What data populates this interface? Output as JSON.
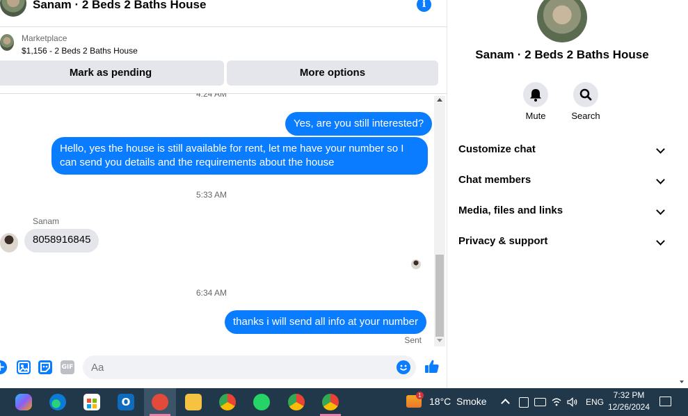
{
  "header": {
    "title": "Sanam · 2 Beds 2 Baths House"
  },
  "listing": {
    "marketplace_label": "Marketplace",
    "price_title": "$1,156 - 2 Beds 2 Baths House",
    "mark_pending": "Mark as pending",
    "more_options": "More options"
  },
  "messages": {
    "time1": "4:24 AM",
    "out1": "Yes, are you still interested?",
    "out2": "Hello, yes the house is still available for rent, let me have your number so I can send you details and the requirements about the house",
    "time2": "5:33 AM",
    "sender_name": "Sanam",
    "in1": "8058916845",
    "time3": "6:34 AM",
    "out3": "thanks i will send all info at your number",
    "status": "Sent"
  },
  "composer": {
    "placeholder": "Aa"
  },
  "side": {
    "title": "Sanam · 2 Beds 2 Baths House",
    "mute": "Mute",
    "search": "Search",
    "sections": [
      "Customize chat",
      "Chat members",
      "Media, files and links",
      "Privacy & support"
    ]
  },
  "taskbar": {
    "weather_temp": "18°C",
    "weather_desc": "Smoke",
    "weather_badge": "1",
    "lang": "ENG",
    "time": "7:32 PM",
    "date": "12/26/2024"
  },
  "colors": {
    "accent": "#0a7cff",
    "taskbar": "#20384a",
    "bubble_in": "#e4e6eb"
  }
}
